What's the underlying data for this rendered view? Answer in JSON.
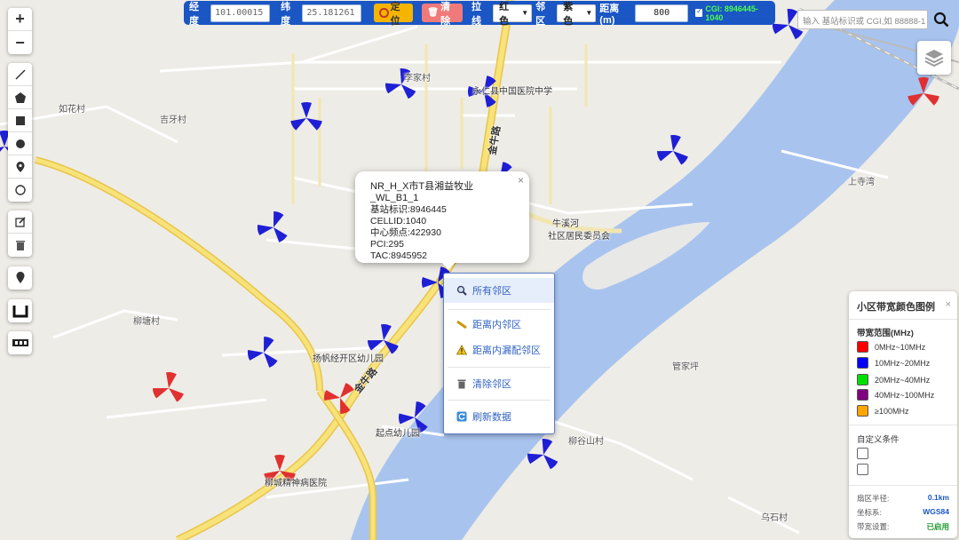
{
  "toolbar": {
    "lng_label": "经度",
    "lng_value": "101.00015",
    "lat_label": "纬度",
    "lat_value": "25.181261",
    "locate_label": "定位",
    "clear_label": "清除",
    "line_label": "拉线",
    "line_color": "红色",
    "neighbor_label": "邻区",
    "neighbor_color": "紫色",
    "distance_label": "距离(m)",
    "distance_value": "800",
    "cgi_status": "CGI: 8946445-1040"
  },
  "search": {
    "placeholder": "输入 基站标识或 CGI,如 88888-1"
  },
  "map_labels": {
    "l1": "李家村",
    "l2": "永仁县中国医院中学",
    "l3": "如花村",
    "l4": "吉牙村",
    "l5": "牛溪河",
    "l6": "社区居民委员会",
    "l7": "上寺湾",
    "l8": "柳塘村",
    "l9": "扬帆经开区幼儿园",
    "l10": "起点幼儿园",
    "l11": "柳谷山村",
    "l12": "管家坪",
    "l13": "柳城精神病医院",
    "l14": "乌石村",
    "road1": "金牛路",
    "road2": "金牛路"
  },
  "popup": {
    "title": "NR_H_X市T县湘益牧业_WL_B1_1",
    "lines": [
      "基站标识:8946445",
      "CELLID:1040",
      "中心频点:422930",
      "PCI:295",
      "TAC:8945952"
    ],
    "close": "×"
  },
  "context_menu": {
    "items": [
      {
        "label": "所有邻区",
        "icon": "magnifier-icon"
      },
      {
        "label": "距离内邻区",
        "icon": "ruler-icon"
      },
      {
        "label": "距离内漏配邻区",
        "icon": "warning-icon"
      },
      {
        "label": "清除邻区",
        "icon": "trash-icon"
      },
      {
        "label": "刷新数据",
        "icon": "refresh-icon"
      }
    ]
  },
  "legend": {
    "title": "小区带宽颜色图例",
    "close": "×",
    "range_title": "带宽范围(MHz)",
    "items": [
      {
        "label": "0MHz~10MHz",
        "color": "#ff0000"
      },
      {
        "label": "10MHz~20MHz",
        "color": "#0000ff"
      },
      {
        "label": "20MHz~40MHz",
        "color": "#00e000"
      },
      {
        "label": "40MHz~100MHz",
        "color": "#800080"
      },
      {
        "label": "≥100MHz",
        "color": "#ffa500"
      }
    ],
    "custom_title": "自定义条件",
    "radius_label": "扇区半径:",
    "radius_value": "0.1km",
    "coord_label": "坐标系:",
    "coord_value": "WGS84",
    "bw_label": "带宽设置:",
    "bw_value": "已启用"
  },
  "colors": {
    "toolbar_bg": "#1a56c4",
    "river": "#a8c4ee",
    "road_main": "#f5d96b",
    "sector_blue": "#1f1fd6",
    "sector_red": "#e03030"
  }
}
